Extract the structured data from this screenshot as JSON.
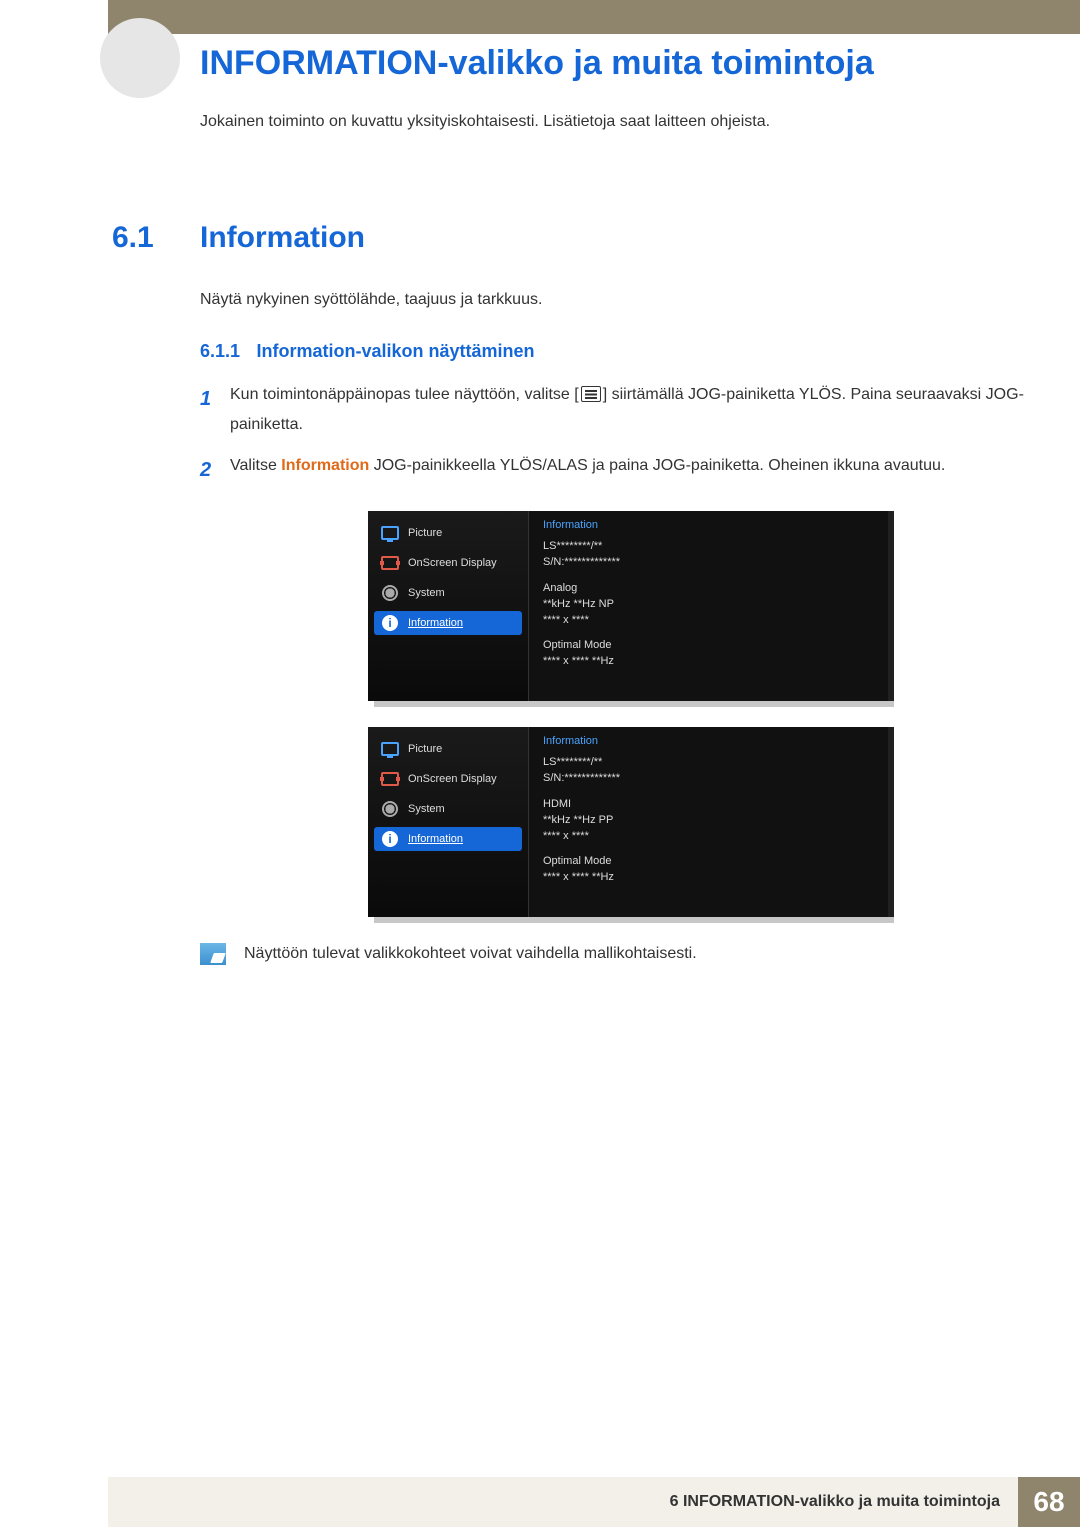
{
  "header": {
    "chapter_title": "INFORMATION-valikko ja muita toimintoja",
    "intro": "Jokainen toiminto on kuvattu yksityiskohtaisesti. Lisätietoja saat laitteen ohjeista."
  },
  "section": {
    "num": "6.1",
    "title": "Information",
    "desc": "Näytä nykyinen syöttölähde, taajuus ja tarkkuus."
  },
  "subsection": {
    "num": "6.1.1",
    "title": "Information-valikon näyttäminen"
  },
  "steps": {
    "s1_num": "1",
    "s1_a": "Kun toimintonäppäinopas tulee näyttöön, valitse [",
    "s1_b": "] siirtämällä JOG-painiketta YLÖS. Paina seuraavaksi JOG-painiketta.",
    "s2_num": "2",
    "s2_a": "Valitse ",
    "s2_info": "Information",
    "s2_b": " JOG-painikkeella YLÖS/ALAS ja paina JOG-painiketta. Oheinen ikkuna avautuu."
  },
  "osd": {
    "menu": {
      "picture": "Picture",
      "onscreen": "OnScreen Display",
      "system": "System",
      "information": "Information"
    },
    "pane_title": "Information",
    "panel1": {
      "model": "LS********/**",
      "sn": "S/N:*************",
      "source": "Analog",
      "freq": "**kHz **Hz NP",
      "res": "**** x ****",
      "opt_label": "Optimal Mode",
      "opt_val": "**** x **** **Hz"
    },
    "panel2": {
      "model": "LS********/**",
      "sn": "S/N:*************",
      "source": "HDMI",
      "freq": "**kHz **Hz PP",
      "res": "**** x ****",
      "opt_label": "Optimal Mode",
      "opt_val": "**** x **** **Hz"
    }
  },
  "note": "Näyttöön tulevat valikkokohteet voivat vaihdella mallikohtaisesti.",
  "footer": {
    "text": "6 INFORMATION-valikko ja muita toimintoja",
    "page": "68"
  }
}
